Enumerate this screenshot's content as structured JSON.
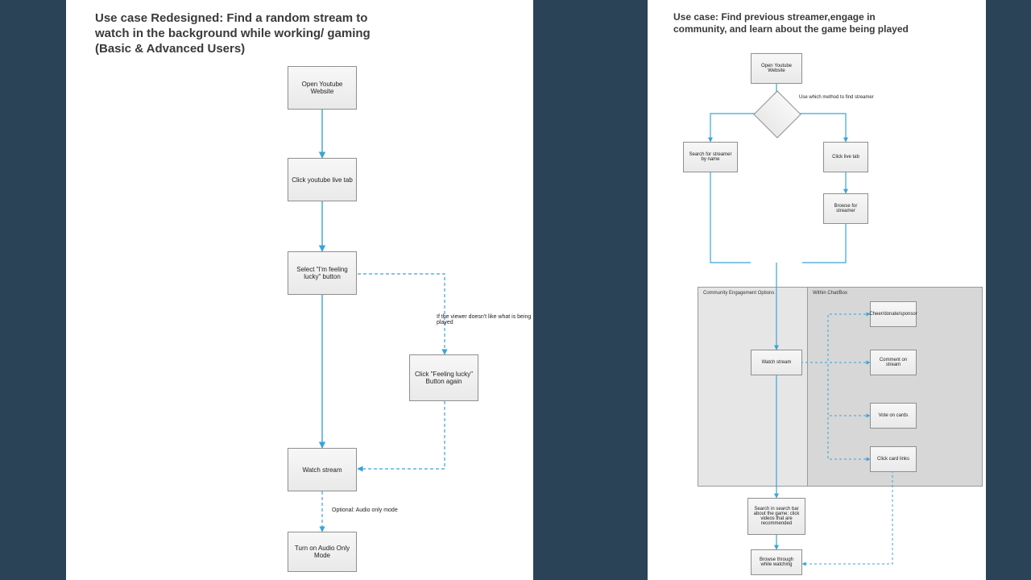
{
  "left": {
    "title": "Use case Redesigned: Find a random stream to watch in the background while working/ gaming (Basic & Advanced Users)",
    "nodes": {
      "n1": "Open Youtube Website",
      "n2": "Click youtube live tab",
      "n3": "Select \"I'm feeling lucky\" button",
      "n4": "Click \"Feeling lucky\" Button again",
      "n5": "Watch stream",
      "n6": "Turn on Audio Only Mode"
    },
    "annotations": {
      "a1": "If the viewer doesn't like what is being played",
      "a2": "Optional: Audio only mode"
    }
  },
  "right": {
    "title": "Use case: Find previous streamer,engage in community, and learn about the game being played",
    "nodes": {
      "r1": "Open Youtube Website",
      "r2": "Search for streamer by name",
      "r3": "Click live tab",
      "r4": "Browse for streamer",
      "r5": "Watch stream",
      "r6": "Cheer/donate/sponsor",
      "r7": "Comment on stream",
      "r8": "Vote on cards",
      "r9": "Click card links",
      "r10": "Search in search bar about the game; click videos that are recommended",
      "r11": "Browse through while watching"
    },
    "decisionLabel": "Use which method to find streamer",
    "regions": {
      "outer": "Community Engagement Options",
      "inner": "Within Chat/Box"
    }
  }
}
